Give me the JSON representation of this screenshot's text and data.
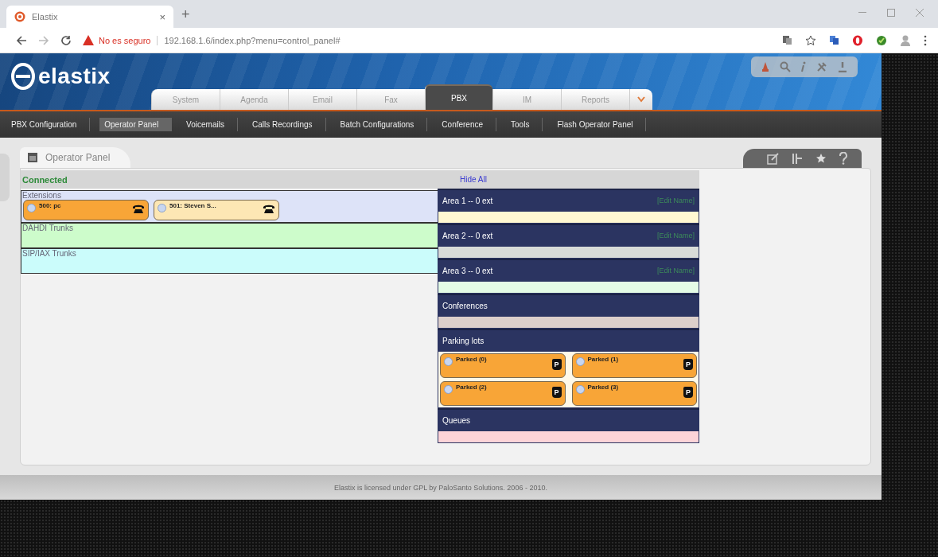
{
  "browser": {
    "tab": {
      "title": "Elastix",
      "close": "×"
    },
    "new_tab": "+",
    "security": "No es seguro",
    "url": "192.168.1.6/index.php?menu=control_panel#"
  },
  "header": {
    "logo": "elastix",
    "tabs": [
      {
        "label": "System",
        "selected": false
      },
      {
        "label": "Agenda",
        "selected": false
      },
      {
        "label": "Email",
        "selected": false
      },
      {
        "label": "Fax",
        "selected": false
      },
      {
        "label": "PBX",
        "selected": true
      },
      {
        "label": "IM",
        "selected": false
      },
      {
        "label": "Reports",
        "selected": false
      }
    ]
  },
  "subnav": [
    {
      "label": "PBX Configuration",
      "selected": false
    },
    {
      "label": "Operator Panel",
      "selected": true
    },
    {
      "label": "Voicemails",
      "selected": false
    },
    {
      "label": "Calls Recordings",
      "selected": false
    },
    {
      "label": "Batch Configurations",
      "selected": false
    },
    {
      "label": "Conference",
      "selected": false
    },
    {
      "label": "Tools",
      "selected": false
    },
    {
      "label": "Flash Operator Panel",
      "selected": false
    }
  ],
  "panel": {
    "title": "Operator Panel",
    "status": "Connected",
    "hide_all": "Hide All",
    "groups": [
      {
        "title": "Extensions",
        "color": "#dde3f8",
        "extensions": [
          {
            "label": "500: pc",
            "color": "#f8a537"
          },
          {
            "label": "501: Steven S...",
            "color": "#fde7b4"
          }
        ]
      },
      {
        "title": "DAHDI Trunks",
        "color": "#cdfccb"
      },
      {
        "title": "SIP/IAX Trunks",
        "color": "#cbfcfb"
      }
    ],
    "areas": [
      {
        "kind": "area",
        "title": "Area 1 -- 0 ext",
        "edit": "[Edit Name]",
        "color": "#fff8d2"
      },
      {
        "kind": "area",
        "title": "Area 2 -- 0 ext",
        "edit": "[Edit Name]",
        "color": "#d8dbd8"
      },
      {
        "kind": "area",
        "title": "Area 3 -- 0 ext",
        "edit": "[Edit Name]",
        "color": "#e4fbe6"
      },
      {
        "kind": "section",
        "title": "Conferences",
        "color": "#dccfcb"
      },
      {
        "kind": "parking",
        "title": "Parking lots",
        "color": "#fff9e8",
        "slots": [
          {
            "label": "Parked (0)",
            "badge": "P"
          },
          {
            "label": "Parked (1)",
            "badge": "P"
          },
          {
            "label": "Parked (2)",
            "badge": "P"
          },
          {
            "label": "Parked (3)",
            "badge": "P"
          }
        ]
      },
      {
        "kind": "section",
        "title": "Queues",
        "color": "#fdd4d8"
      }
    ]
  },
  "footer": "Elastix is licensed under GPL by PaloSanto Solutions. 2006 - 2010."
}
